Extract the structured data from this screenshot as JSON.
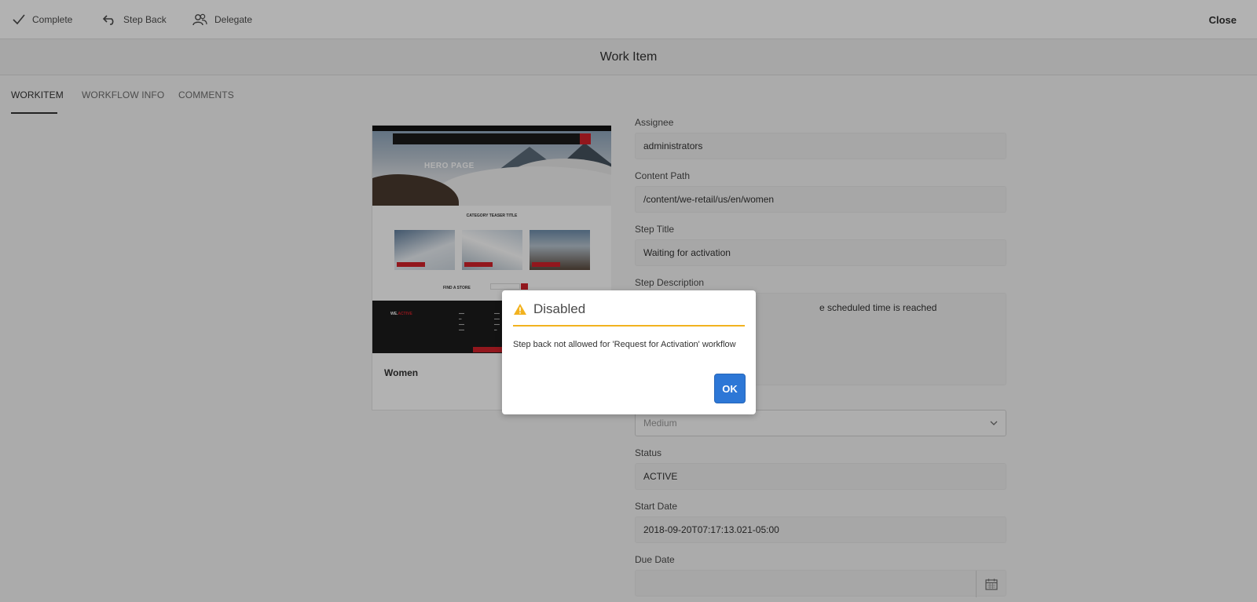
{
  "toolbar": {
    "complete_label": "Complete",
    "step_back_label": "Step Back",
    "delegate_label": "Delegate",
    "close_label": "Close"
  },
  "title": "Work Item",
  "tabs": [
    {
      "label": "WORKITEM",
      "active": true
    },
    {
      "label": "WORKFLOW INFO",
      "active": false
    },
    {
      "label": "COMMENTS",
      "active": false
    }
  ],
  "preview": {
    "hero_text": "HERO PAGE",
    "category_title": "CATEGORY TEASER TITLE",
    "find_store": "FIND A STORE",
    "brand": "WE.",
    "brand_accent": "ACTIVE",
    "label": "Women"
  },
  "form": {
    "assignee": {
      "label": "Assignee",
      "value": "administrators"
    },
    "content_path": {
      "label": "Content Path",
      "value": "/content/we-retail/us/en/women"
    },
    "step_title": {
      "label": "Step Title",
      "value": "Waiting for activation"
    },
    "step_description": {
      "label": "Step Description",
      "value": "e scheduled time is reached"
    },
    "priority": {
      "value": "Medium"
    },
    "status": {
      "label": "Status",
      "value": "ACTIVE"
    },
    "start_date": {
      "label": "Start Date",
      "value": "2018-09-20T07:17:13.021-05:00"
    },
    "due_date": {
      "label": "Due Date",
      "value": ""
    }
  },
  "dialog": {
    "title": "Disabled",
    "message": "Step back not allowed for 'Request for Activation' workflow",
    "ok_label": "OK",
    "accent_color": "#f2b21f",
    "button_color": "#2d77d6"
  }
}
